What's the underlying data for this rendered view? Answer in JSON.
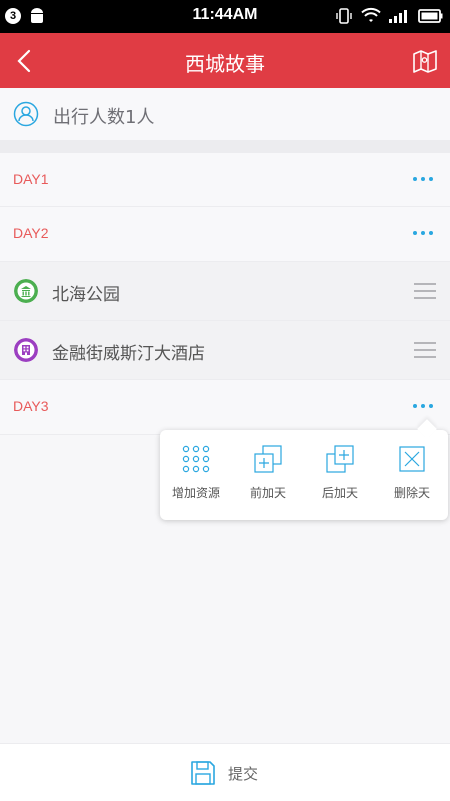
{
  "status_bar": {
    "time": "11:44AM",
    "notification_count": "3"
  },
  "header": {
    "title": "西城故事"
  },
  "travelers": {
    "label": "出行人数1人"
  },
  "days": [
    {
      "label": "DAY1"
    },
    {
      "label": "DAY2"
    },
    {
      "label": "DAY3"
    }
  ],
  "pois": [
    {
      "name": "北海公园",
      "icon": "park-icon",
      "color": "#4caf50"
    },
    {
      "name": "金融街威斯汀大酒店",
      "icon": "hotel-icon",
      "color": "#9c3fc1"
    }
  ],
  "popup_menu": {
    "items": [
      {
        "label": "增加资源",
        "icon": "grid-icon"
      },
      {
        "label": "前加天",
        "icon": "add-before-icon"
      },
      {
        "label": "后加天",
        "icon": "add-after-icon"
      },
      {
        "label": "删除天",
        "icon": "delete-icon"
      }
    ]
  },
  "footer": {
    "submit_label": "提交"
  },
  "colors": {
    "header": "#e03c44",
    "accent": "#2aa7e0",
    "day_label": "#e85a5a"
  }
}
